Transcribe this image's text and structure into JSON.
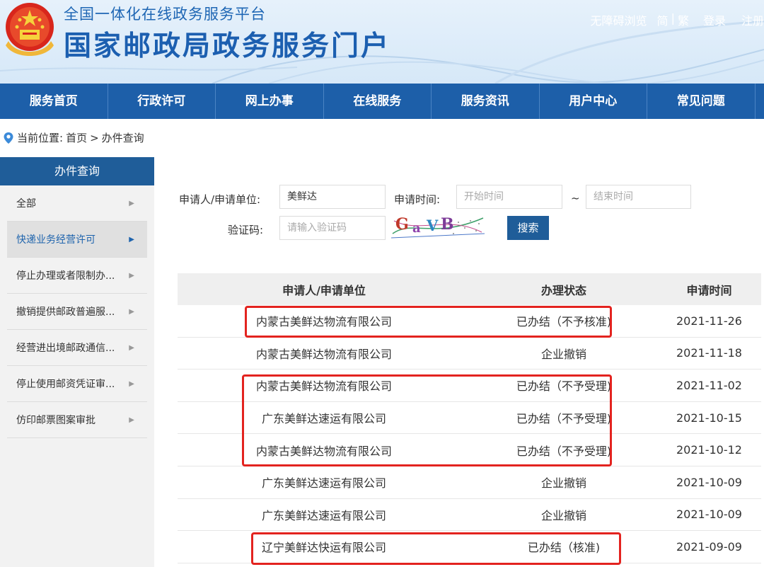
{
  "header": {
    "platform_name": "全国一体化在线政务服务平台",
    "portal_title": "国家邮政局政务服务门户",
    "links": {
      "accessibility": "无障碍浏览",
      "simplified": "简",
      "separator": "|",
      "traditional": "繁",
      "login": "登录",
      "register": "注册"
    }
  },
  "nav": {
    "items": [
      "服务首页",
      "行政许可",
      "网上办事",
      "在线服务",
      "服务资讯",
      "用户中心",
      "常见问题"
    ]
  },
  "breadcrumb": {
    "label": "当前位置:",
    "home": "首页",
    "separator": ">",
    "current": "办件查询"
  },
  "sidebar": {
    "title": "办件查询",
    "items": [
      "全部",
      "快递业务经营许可",
      "停止办理或者限制办...",
      "撤销提供邮政普遍服...",
      "经营进出境邮政通信...",
      "停止使用邮资凭证审...",
      "仿印邮票图案审批"
    ],
    "active_index": 1
  },
  "search": {
    "applicant_label": "申请人/申请单位:",
    "applicant_value": "美鲜达",
    "time_label": "申请时间:",
    "start_placeholder": "开始时间",
    "range_separator": "~",
    "end_placeholder": "结束时间",
    "captcha_label": "验证码:",
    "captcha_placeholder": "请输入验证码",
    "captcha_text": "GaVB",
    "search_button": "搜索"
  },
  "table": {
    "headers": [
      "申请人/申请单位",
      "办理状态",
      "申请时间"
    ],
    "rows": [
      [
        "内蒙古美鲜达物流有限公司",
        "已办结（不予核准)",
        "2021-11-26"
      ],
      [
        "内蒙古美鲜达物流有限公司",
        "企业撤销",
        "2021-11-18"
      ],
      [
        "内蒙古美鲜达物流有限公司",
        "已办结（不予受理)",
        "2021-11-02"
      ],
      [
        "广东美鲜达速运有限公司",
        "已办结（不予受理)",
        "2021-10-15"
      ],
      [
        "内蒙古美鲜达物流有限公司",
        "已办结（不予受理)",
        "2021-10-12"
      ],
      [
        "广东美鲜达速运有限公司",
        "企业撤销",
        "2021-10-09"
      ],
      [
        "广东美鲜达速运有限公司",
        "企业撤销",
        "2021-10-09"
      ],
      [
        "辽宁美鲜达快运有限公司",
        "已办结（核准)",
        "2021-09-09"
      ]
    ]
  },
  "colors": {
    "brand_blue": "#1d5fa9",
    "highlight_red": "#e3231f"
  }
}
